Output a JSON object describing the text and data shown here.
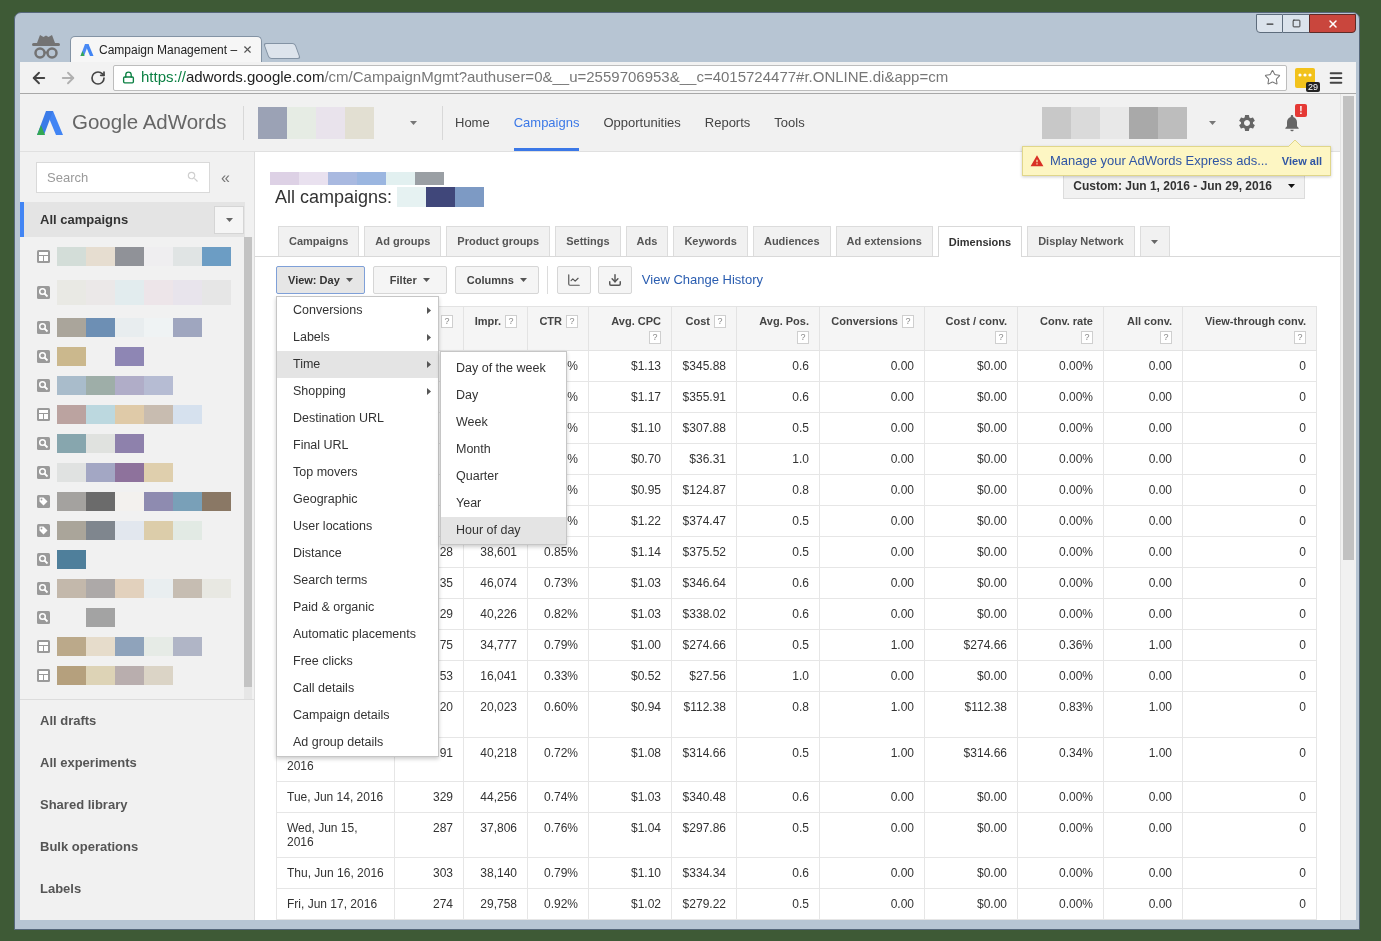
{
  "browser": {
    "tabs": [
      {
        "title": "Campaign Management –",
        "selected": true
      }
    ],
    "address": {
      "scheme": "https://",
      "host": "adwords.google.com",
      "path": "/cm/CampaignMgmt?authuser=0&__u=2559706953&__c=4015724477#r.ONLINE.di&app=cm"
    },
    "extension_badge": "29"
  },
  "header": {
    "logo": "Google AdWords",
    "nav": [
      {
        "label": "Home",
        "selected": false
      },
      {
        "label": "Campaigns",
        "selected": true
      },
      {
        "label": "Opportunities",
        "selected": false
      },
      {
        "label": "Reports",
        "selected": false
      },
      {
        "label": "Tools",
        "selected": false
      }
    ],
    "alert_badge": "!",
    "notice": {
      "message": "Manage your AdWords Express ads...",
      "link": "View all"
    }
  },
  "sidebar": {
    "search": {
      "placeholder": "Search"
    },
    "collapse": "«",
    "scope": {
      "label": "All campaigns",
      "selected": true
    },
    "campaigns": [
      {
        "kind": "display"
      },
      {
        "kind": "search"
      },
      {
        "kind": "search"
      },
      {
        "kind": "search"
      },
      {
        "kind": "search"
      },
      {
        "kind": "display"
      },
      {
        "kind": "search"
      },
      {
        "kind": "search"
      },
      {
        "kind": "shopping"
      },
      {
        "kind": "shopping"
      },
      {
        "kind": "search"
      },
      {
        "kind": "search"
      },
      {
        "kind": "search"
      },
      {
        "kind": "display"
      },
      {
        "kind": "display"
      }
    ],
    "links": [
      "All drafts",
      "All experiments",
      "Shared library",
      "Bulk operations",
      "Labels"
    ]
  },
  "main": {
    "title": "All campaigns:",
    "date_range": "Custom: Jun 1, 2016 - Jun 29, 2016",
    "tabs": [
      {
        "label": "Campaigns",
        "selected": false
      },
      {
        "label": "Ad groups",
        "selected": false
      },
      {
        "label": "Product groups",
        "selected": false
      },
      {
        "label": "Settings",
        "selected": false
      },
      {
        "label": "Ads",
        "selected": false
      },
      {
        "label": "Keywords",
        "selected": false
      },
      {
        "label": "Audiences",
        "selected": false
      },
      {
        "label": "Ad extensions",
        "selected": false
      },
      {
        "label": "Dimensions",
        "selected": true
      },
      {
        "label": "Display Network",
        "selected": false
      }
    ],
    "toolbar": {
      "buttons": [
        {
          "label": "View: Day",
          "open": true
        },
        {
          "label": "Filter",
          "open": false
        },
        {
          "label": "Columns",
          "open": false
        }
      ],
      "link": "View Change History"
    },
    "view_menu": {
      "items": [
        {
          "label": "Conversions",
          "submenu": true,
          "highlighted": false
        },
        {
          "label": "Labels",
          "submenu": true,
          "highlighted": false
        },
        {
          "label": "Time",
          "submenu": true,
          "highlighted": true,
          "children": [
            {
              "label": "Day of the week",
              "highlighted": false
            },
            {
              "label": "Day",
              "highlighted": false
            },
            {
              "label": "Week",
              "highlighted": false
            },
            {
              "label": "Month",
              "highlighted": false
            },
            {
              "label": "Quarter",
              "highlighted": false
            },
            {
              "label": "Year",
              "highlighted": false
            },
            {
              "label": "Hour of day",
              "highlighted": true
            }
          ]
        },
        {
          "label": "Shopping",
          "submenu": true,
          "highlighted": false
        },
        {
          "label": "Destination URL",
          "submenu": false,
          "highlighted": false
        },
        {
          "label": "Final URL",
          "submenu": false,
          "highlighted": false
        },
        {
          "label": "Top movers",
          "submenu": false,
          "highlighted": false
        },
        {
          "label": "Geographic",
          "submenu": false,
          "highlighted": false
        },
        {
          "label": "User locations",
          "submenu": false,
          "highlighted": false
        },
        {
          "label": "Distance",
          "submenu": false,
          "highlighted": false
        },
        {
          "label": "Search terms",
          "submenu": false,
          "highlighted": false
        },
        {
          "label": "Paid & organic",
          "submenu": false,
          "highlighted": false
        },
        {
          "label": "Automatic placements",
          "submenu": false,
          "highlighted": false
        },
        {
          "label": "Free clicks",
          "submenu": false,
          "highlighted": false
        },
        {
          "label": "Call details",
          "submenu": false,
          "highlighted": false
        },
        {
          "label": "Campaign details",
          "submenu": false,
          "highlighted": false
        },
        {
          "label": "Ad group details",
          "submenu": false,
          "highlighted": false
        }
      ]
    },
    "table": {
      "columns": [
        {},
        {
          "help": "?"
        },
        {
          "label": "Impr.",
          "help": "?"
        },
        {
          "label": "CTR",
          "help": "?"
        },
        {
          "label": "Avg. CPC",
          "help": "?"
        },
        {
          "label": "Cost",
          "help": "?"
        },
        {
          "label": "Avg. Pos.",
          "help": "?"
        },
        {
          "label": "Conversions",
          "help": "?"
        },
        {
          "label": "Cost / conv.",
          "help": "?"
        },
        {
          "label": "Conv. rate",
          "help": "?"
        },
        {
          "label": "All conv.",
          "help": "?"
        },
        {
          "label": "View-through conv.",
          "help": "?"
        }
      ],
      "rows": [
        [
          null,
          null,
          null,
          "%",
          "$1.13",
          "$345.88",
          "0.6",
          "0.00",
          "$0.00",
          "0.00%",
          "0.00",
          "0"
        ],
        [
          null,
          null,
          null,
          "%",
          "$1.17",
          "$355.91",
          "0.6",
          "0.00",
          "$0.00",
          "0.00%",
          "0.00",
          "0"
        ],
        [
          null,
          null,
          null,
          "%",
          "$1.10",
          "$307.88",
          "0.5",
          "0.00",
          "$0.00",
          "0.00%",
          "0.00",
          "0"
        ],
        [
          null,
          null,
          null,
          "%",
          "$0.70",
          "$36.31",
          "1.0",
          "0.00",
          "$0.00",
          "0.00%",
          "0.00",
          "0"
        ],
        [
          null,
          null,
          null,
          "%",
          "$0.95",
          "$124.87",
          "0.8",
          "0.00",
          "$0.00",
          "0.00%",
          "0.00",
          "0"
        ],
        [
          null,
          null,
          null,
          "%",
          "$1.22",
          "$374.47",
          "0.5",
          "0.00",
          "$0.00",
          "0.00%",
          "0.00",
          "0"
        ],
        [
          null,
          "28",
          "38,601",
          "0.85%",
          "$1.14",
          "$375.52",
          "0.5",
          "0.00",
          "$0.00",
          "0.00%",
          "0.00",
          "0"
        ],
        [
          null,
          "35",
          "46,074",
          "0.73%",
          "$1.03",
          "$346.64",
          "0.6",
          "0.00",
          "$0.00",
          "0.00%",
          "0.00",
          "0"
        ],
        [
          null,
          "29",
          "40,226",
          "0.82%",
          "$1.03",
          "$338.02",
          "0.6",
          "0.00",
          "$0.00",
          "0.00%",
          "0.00",
          "0"
        ],
        [
          null,
          "75",
          "34,777",
          "0.79%",
          "$1.00",
          "$274.66",
          "0.5",
          "1.00",
          "$274.66",
          "0.36%",
          "1.00",
          "0"
        ],
        [
          null,
          "53",
          "16,041",
          "0.33%",
          "$0.52",
          "$27.56",
          "1.0",
          "0.00",
          "$0.00",
          "0.00%",
          "0.00",
          "0"
        ],
        [
          null,
          "20",
          "20,023",
          "0.60%",
          "$0.94",
          "$112.38",
          "0.8",
          "1.00",
          "$112.38",
          "0.83%",
          "1.00",
          "0"
        ],
        [
          "2016",
          "91",
          "40,218",
          "0.72%",
          "$1.08",
          "$314.66",
          "0.5",
          "1.00",
          "$314.66",
          "0.34%",
          "1.00",
          "0"
        ],
        [
          "Tue, Jun 14, 2016",
          "329",
          "44,256",
          "0.74%",
          "$1.03",
          "$340.48",
          "0.6",
          "0.00",
          "$0.00",
          "0.00%",
          "0.00",
          "0"
        ],
        [
          "Wed, Jun 15, 2016",
          "287",
          "37,806",
          "0.76%",
          "$1.04",
          "$297.86",
          "0.5",
          "0.00",
          "$0.00",
          "0.00%",
          "0.00",
          "0"
        ],
        [
          "Thu, Jun 16, 2016",
          "303",
          "38,140",
          "0.79%",
          "$1.10",
          "$334.34",
          "0.6",
          "0.00",
          "$0.00",
          "0.00%",
          "0.00",
          "0"
        ],
        [
          "Fri, Jun 17, 2016",
          "274",
          "29,758",
          "0.92%",
          "$1.02",
          "$279.22",
          "0.5",
          "0.00",
          "$0.00",
          "0.00%",
          "0.00",
          "0"
        ]
      ]
    }
  }
}
